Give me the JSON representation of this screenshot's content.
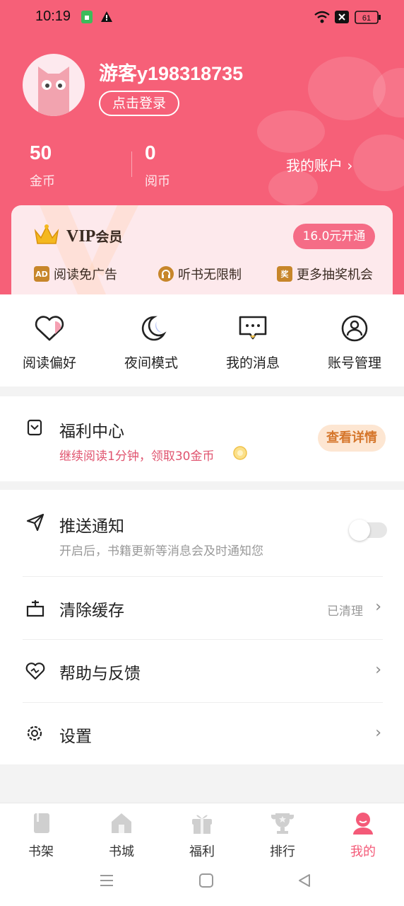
{
  "status_bar": {
    "time": "10:19",
    "battery": "61"
  },
  "profile": {
    "username": "游客y198318735",
    "login_label": "点击登录",
    "coins_value": "50",
    "coins_label": "金币",
    "reading_coins_value": "0",
    "reading_coins_label": "阅币",
    "account_label": "我的账户 ›"
  },
  "vip": {
    "title_prefix": "VIP",
    "title_suffix": "会员",
    "button_label": "16.0元开通",
    "perks": [
      {
        "icon": "AD",
        "label": "阅读免广告"
      },
      {
        "icon": "headphone-icon",
        "label": "听书无限制"
      },
      {
        "icon": "奖",
        "label": "更多抽奖机会"
      }
    ]
  },
  "quick_actions": [
    {
      "label": "阅读偏好",
      "icon": "heart-icon"
    },
    {
      "label": "夜间模式",
      "icon": "moon-icon"
    },
    {
      "label": "我的消息",
      "icon": "message-icon"
    },
    {
      "label": "账号管理",
      "icon": "account-icon"
    }
  ],
  "welfare": {
    "title": "福利中心",
    "subtitle": "继续阅读1分钟，领取30金币",
    "button_label": "查看详情"
  },
  "settings": {
    "push": {
      "title": "推送通知",
      "subtitle": "开启后，书籍更新等消息会及时通知您",
      "enabled": false
    },
    "cache": {
      "title": "清除缓存",
      "value": "已清理"
    },
    "help": {
      "title": "帮助与反馈"
    },
    "settings": {
      "title": "设置"
    }
  },
  "bottom_nav": [
    {
      "label": "书架",
      "icon": "bookshelf-icon",
      "active": false
    },
    {
      "label": "书城",
      "icon": "bookstore-icon",
      "active": false
    },
    {
      "label": "福利",
      "icon": "gift-icon",
      "active": false
    },
    {
      "label": "排行",
      "icon": "trophy-icon",
      "active": false
    },
    {
      "label": "我的",
      "icon": "profile-icon",
      "active": true
    }
  ],
  "colors": {
    "brand": "#f66078",
    "active_tab": "#f45a78",
    "welfare_text": "#e0546f",
    "gold": "#c7862a"
  }
}
